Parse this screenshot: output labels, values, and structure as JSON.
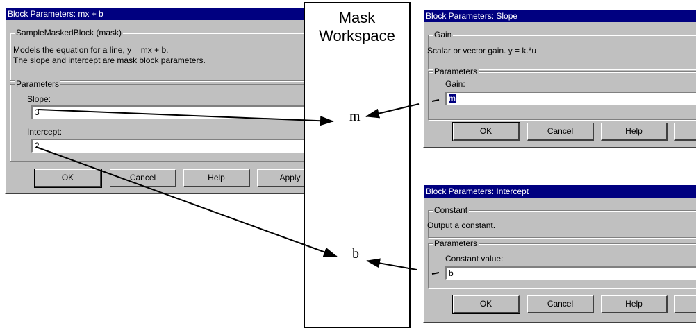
{
  "dialog_mxb": {
    "title": "Block Parameters: mx + b",
    "block_group": "SampleMaskedBlock (mask)",
    "desc_line1": "Models the equation for a line, y = mx + b.",
    "desc_line2": "The slope and intercept are mask block parameters.",
    "params_group": "Parameters",
    "slope_label": "Slope:",
    "slope_value": "3",
    "intercept_label": "Intercept:",
    "intercept_value": "2",
    "buttons": {
      "ok": "OK",
      "cancel": "Cancel",
      "help": "Help",
      "apply": "Apply"
    }
  },
  "mask_workspace": {
    "title_line1": "Mask",
    "title_line2": "Workspace",
    "var_m": "m",
    "var_b": "b"
  },
  "dialog_slope": {
    "title": "Block Parameters: Slope",
    "block_group": "Gain",
    "desc": "Scalar or vector gain. y = k.*u",
    "params_group": "Parameters",
    "gain_label": "Gain:",
    "gain_value": "m",
    "buttons": {
      "ok": "OK",
      "cancel": "Cancel",
      "help": "Help"
    }
  },
  "dialog_intercept": {
    "title": "Block Parameters: Intercept",
    "block_group": "Constant",
    "desc": "Output a constant.",
    "params_group": "Parameters",
    "value_label": "Constant value:",
    "value": "b",
    "buttons": {
      "ok": "OK",
      "cancel": "Cancel",
      "help": "Help"
    }
  }
}
